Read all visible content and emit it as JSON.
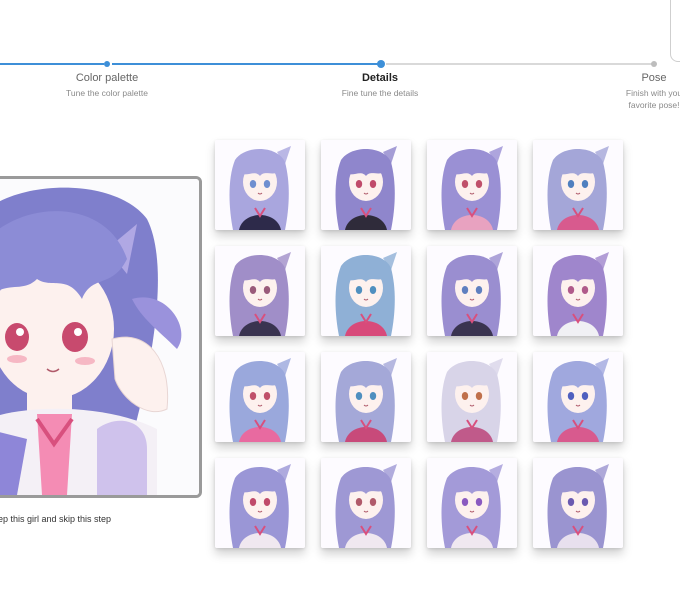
{
  "stepper": {
    "steps": [
      {
        "title": "Color palette",
        "subtitle": "Tune the color palette"
      },
      {
        "title": "Details",
        "subtitle": "Fine tune the details"
      },
      {
        "title": "Pose",
        "subtitle_line1": "Finish with you",
        "subtitle_line2": "favorite pose!"
      }
    ],
    "active_step": "Details",
    "colors": {
      "done": "#3d8fd8",
      "todo": "#d9d9d9"
    }
  },
  "preview": {
    "keep_text": "ep this girl and skip this step",
    "hair_color": "#8e8ed6"
  },
  "grid": {
    "rows": 4,
    "cols": 4,
    "thumbnails": [
      {
        "hair": "#a9a6de",
        "eyes": "#6f8fd0",
        "outfit": "#2d2a4a"
      },
      {
        "hair": "#8f86cc",
        "eyes": "#c04a6a",
        "outfit": "#2f2b3a"
      },
      {
        "hair": "#9a90d4",
        "eyes": "#c0506a",
        "outfit": "#e8a2c0"
      },
      {
        "hair": "#a4a6d8",
        "eyes": "#4f7fbf",
        "outfit": "#d85a8e"
      },
      {
        "hair": "#a08ec8",
        "eyes": "#9a5a7a",
        "outfit": "#3a3450"
      },
      {
        "hair": "#8fb0d6",
        "eyes": "#4f8fbf",
        "outfit": "#d84a7a"
      },
      {
        "hair": "#9a8ed0",
        "eyes": "#5f7fbf",
        "outfit": "#3a3450"
      },
      {
        "hair": "#9f86cc",
        "eyes": "#b05a8a",
        "outfit": "#f0f0f4"
      },
      {
        "hair": "#9aa8dc",
        "eyes": "#c0506a",
        "outfit": "#e86aa0"
      },
      {
        "hair": "#a4a8d8",
        "eyes": "#4f8fbf",
        "outfit": "#c84a7a"
      },
      {
        "hair": "#d8d4e8",
        "eyes": "#c0704a",
        "outfit": "#c05a8a"
      },
      {
        "hair": "#a0a8de",
        "eyes": "#4f5fbf",
        "outfit": "#d85a8e"
      },
      {
        "hair": "#9a96d6",
        "eyes": "#c04a6a",
        "outfit": "#f0e8f0"
      },
      {
        "hair": "#9e98d4",
        "eyes": "#b05a6a",
        "outfit": "#f0e8f0"
      },
      {
        "hair": "#a39ad8",
        "eyes": "#8a5ac0",
        "outfit": "#f0e8f0"
      },
      {
        "hair": "#9a94d0",
        "eyes": "#6a5ab0",
        "outfit": "#e8e0ee"
      }
    ]
  }
}
